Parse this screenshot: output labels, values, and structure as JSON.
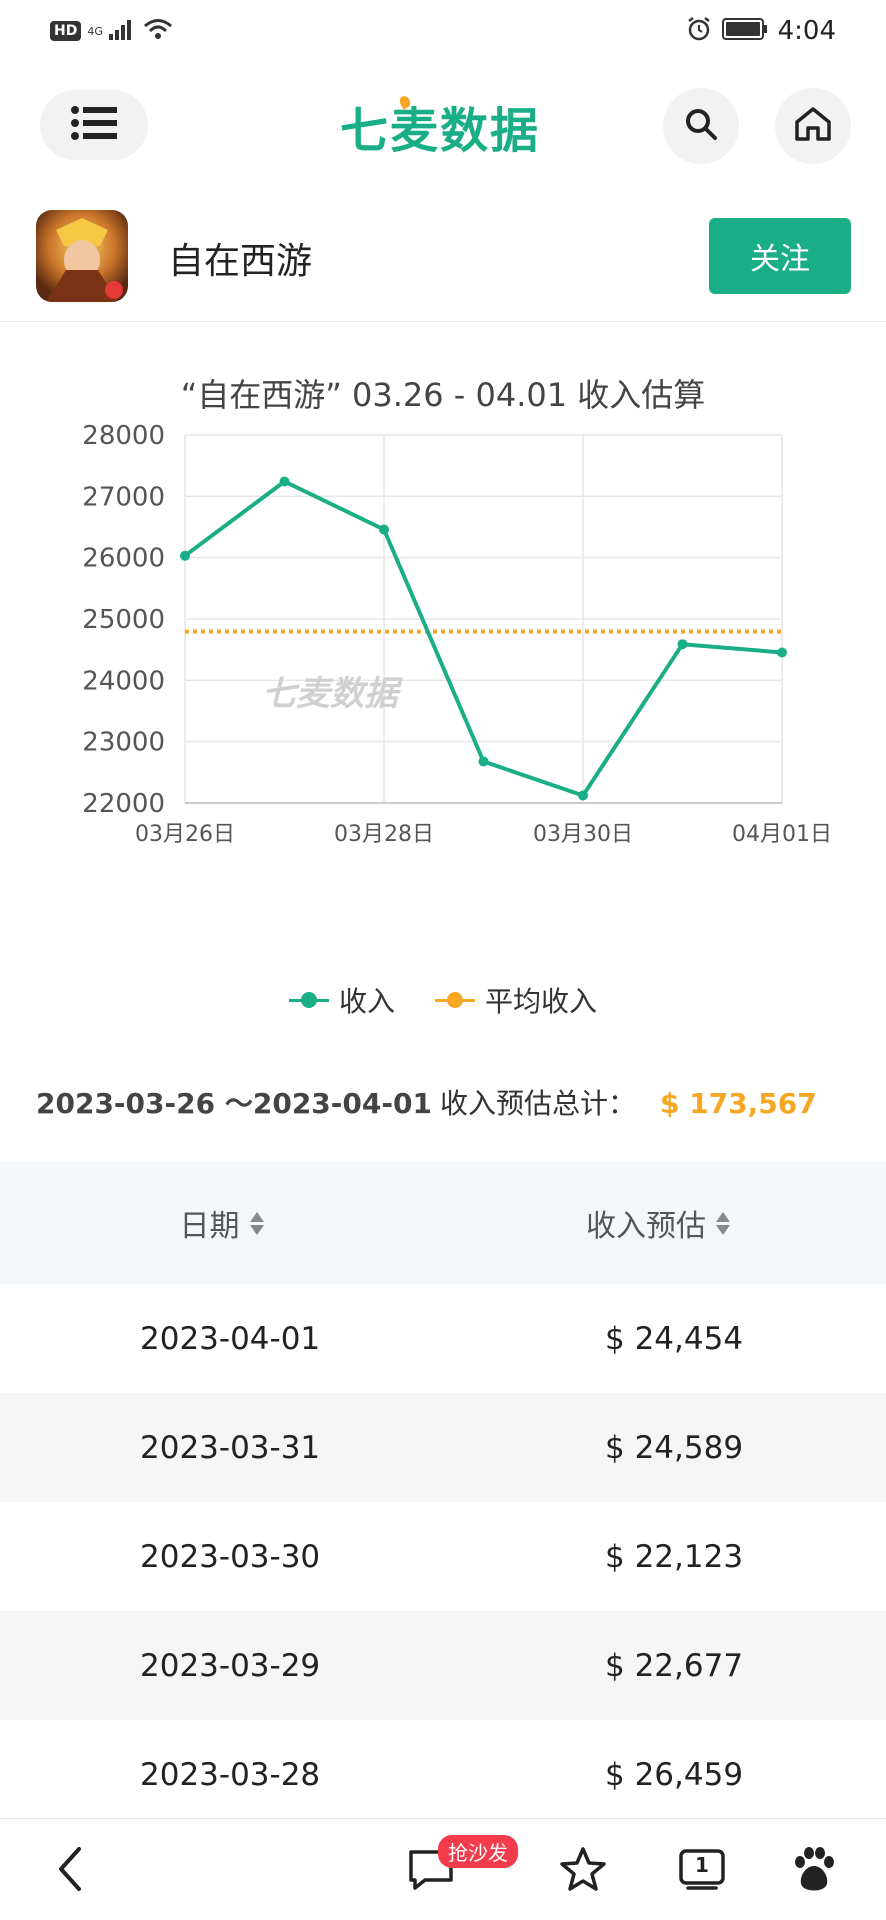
{
  "status_bar": {
    "hd": "HD",
    "network": "4G",
    "time": "4:04"
  },
  "header": {
    "logo": "七麦数据"
  },
  "app": {
    "name": "自在西游",
    "follow_label": "关注"
  },
  "chart": {
    "watermark": "七麦数据",
    "legend_income": "收入",
    "legend_avg": "平均收入",
    "colors": {
      "income": "#1aae87",
      "average": "#f5a623"
    }
  },
  "chart_data": {
    "type": "line",
    "title": "“自在西游” 03.26 - 04.01 收入估算",
    "x": [
      "03月26日",
      "03月27日",
      "03月28日",
      "03月29日",
      "03月30日",
      "03月31日",
      "04月01日"
    ],
    "x_tick_labels": [
      "03月26日",
      "03月28日",
      "03月30日",
      "04月01日"
    ],
    "series": [
      {
        "name": "收入",
        "values": [
          26032,
          27242,
          26459,
          22677,
          22123,
          24589,
          24454
        ]
      },
      {
        "name": "平均收入",
        "values": [
          24795,
          24795,
          24795,
          24795,
          24795,
          24795,
          24795
        ]
      }
    ],
    "ylim": [
      22000,
      28000
    ],
    "y_ticks": [
      "22000",
      "23000",
      "24000",
      "25000",
      "26000",
      "27000",
      "28000"
    ],
    "grid": true,
    "legend_position": "bottom"
  },
  "total": {
    "range": "2023-03-26 ～2023-04-01",
    "label": "收入预估总计：",
    "value": "$ 173,567"
  },
  "table": {
    "col_date": "日期",
    "col_income": "收入预估",
    "rows": [
      {
        "date": "2023-04-01",
        "income": "$ 24,454"
      },
      {
        "date": "2023-03-31",
        "income": "$ 24,589"
      },
      {
        "date": "2023-03-30",
        "income": "$ 22,123"
      },
      {
        "date": "2023-03-29",
        "income": "$ 22,677"
      },
      {
        "date": "2023-03-28",
        "income": "$ 26,459"
      }
    ]
  },
  "bottom_bar": {
    "comment_badge": "抢沙发",
    "tabs_count": "1"
  }
}
